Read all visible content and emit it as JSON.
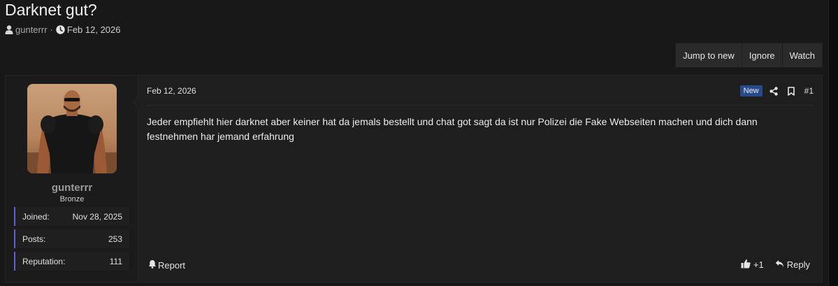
{
  "thread": {
    "title": "Darknet gut?",
    "author": "gunterrr",
    "separator": "·",
    "date": "Feb 12, 2026"
  },
  "actions": {
    "jump_to_new": "Jump to new",
    "ignore": "Ignore",
    "watch": "Watch"
  },
  "post": {
    "date": "Feb 12, 2026",
    "badge": "New",
    "number": "#1",
    "body": "Jeder empfiehlt hier darknet aber keiner hat da jemals bestellt und chat got sagt da ist nur Polizei die Fake Webseiten machen und dich dann festnehmen har jemand erfahrung",
    "report_label": "Report",
    "reaction_count": "+1",
    "reply_label": "Reply"
  },
  "user": {
    "name": "gunterrr",
    "rank": "Bronze",
    "stats": [
      {
        "label": "Joined:",
        "value": "Nov 28, 2025"
      },
      {
        "label": "Posts:",
        "value": "253"
      },
      {
        "label": "Reputation:",
        "value": "111"
      }
    ]
  },
  "icons": {
    "user": "user-icon",
    "clock": "clock-icon",
    "share": "share-icon",
    "bookmark": "bookmark-icon",
    "bell": "bell-icon",
    "thumbs_up": "thumbs-up-icon",
    "reply": "reply-icon"
  },
  "colors": {
    "background": "#181818",
    "post_background": "#1e1e1e",
    "stat_accent": "#5b63c4",
    "badge_new": "#284a8a",
    "username": "#9a9a9a"
  }
}
